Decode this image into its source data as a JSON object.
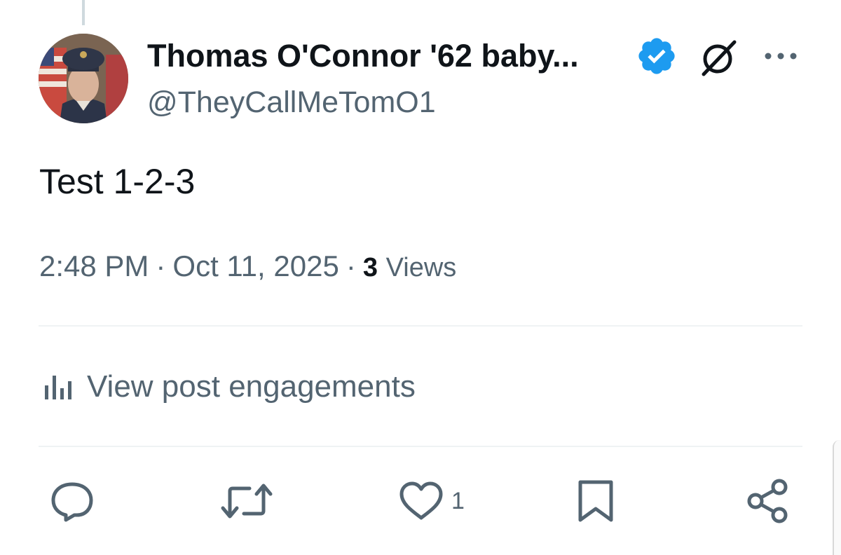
{
  "post": {
    "author": {
      "display_name": "Thomas O'Connor '62 baby...",
      "handle": "@TheyCallMeTomO1",
      "verified": true
    },
    "text": "Test 1-2-3",
    "time": "2:48 PM",
    "date": "Oct 11, 2025",
    "separator": "·",
    "views_count": "3",
    "views_label": "Views"
  },
  "engagements": {
    "label": "View post engagements"
  },
  "actions": {
    "reply_count": "",
    "repost_count": "",
    "like_count": "1"
  },
  "colors": {
    "text_primary": "#0f1419",
    "text_secondary": "#536471",
    "verified_blue": "#1d9bf0",
    "divider": "#eff3f4"
  },
  "icons": [
    "reply-icon",
    "repost-icon",
    "like-icon",
    "bookmark-icon",
    "share-icon",
    "grok-icon",
    "more-icon",
    "verified-badge-icon",
    "analytics-icon"
  ]
}
